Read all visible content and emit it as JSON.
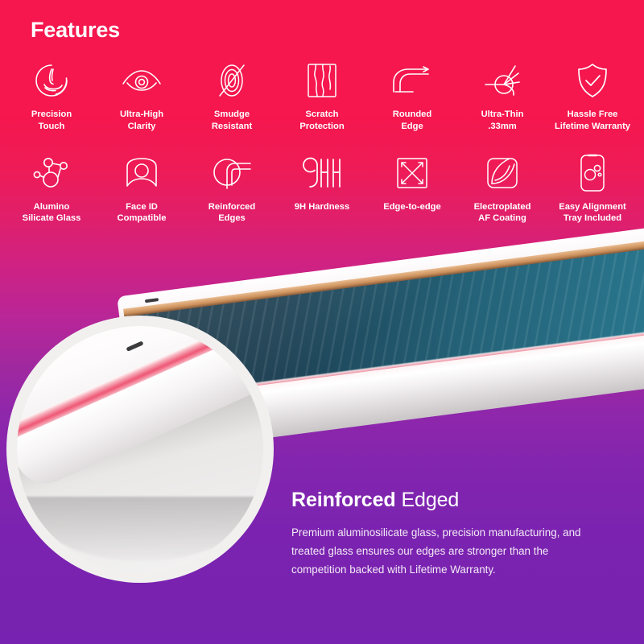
{
  "header": {
    "title": "Features"
  },
  "theme": {
    "gradient_top": "#F5174E",
    "gradient_bottom": "#7722B0",
    "text_color": "#FFFFFF",
    "screen_color": "#1D4154",
    "edge_glow": "#EE5B79"
  },
  "features": [
    {
      "icon": "fingertip-touch-icon",
      "label": "Precision\nTouch"
    },
    {
      "icon": "eye-icon",
      "label": "Ultra-High\nClarity"
    },
    {
      "icon": "fingerprint-slash-icon",
      "label": "Smudge\nResistant"
    },
    {
      "icon": "cracked-square-icon",
      "label": "Scratch\nProtection"
    },
    {
      "icon": "rounded-edge-arrow-icon",
      "label": "Rounded\nEdge"
    },
    {
      "icon": "caliper-thickness-icon",
      "label": "Ultra-Thin\n.33mm"
    },
    {
      "icon": "shield-check-icon",
      "label": "Hassle Free\nLifetime Warranty"
    },
    {
      "icon": "molecule-icon",
      "label": "Alumino\nSilicate Glass"
    },
    {
      "icon": "face-portrait-icon",
      "label": "Face ID\nCompatible"
    },
    {
      "icon": "reinforced-corner-icon",
      "label": "Reinforced\nEdges"
    },
    {
      "icon": "nine-h-hardness-icon",
      "label": "9H Hardness"
    },
    {
      "icon": "edge-to-edge-square-icon",
      "label": "Edge-to-edge"
    },
    {
      "icon": "peeling-film-icon",
      "label": "Electroplated\nAF Coating"
    },
    {
      "icon": "phone-tray-bubbles-icon",
      "label": "Easy Alignment\nTray Included"
    }
  ],
  "hero": {
    "magnifier_name": "magnifier-circle",
    "device_name": "tempered-glass-on-phone"
  },
  "copy": {
    "title_strong": "Reinforced",
    "title_light": " Edged",
    "body": "Premium aluminosilicate glass, precision manufacturing, and treated glass ensures our edges are stronger than the competition backed with Lifetime Warranty."
  }
}
